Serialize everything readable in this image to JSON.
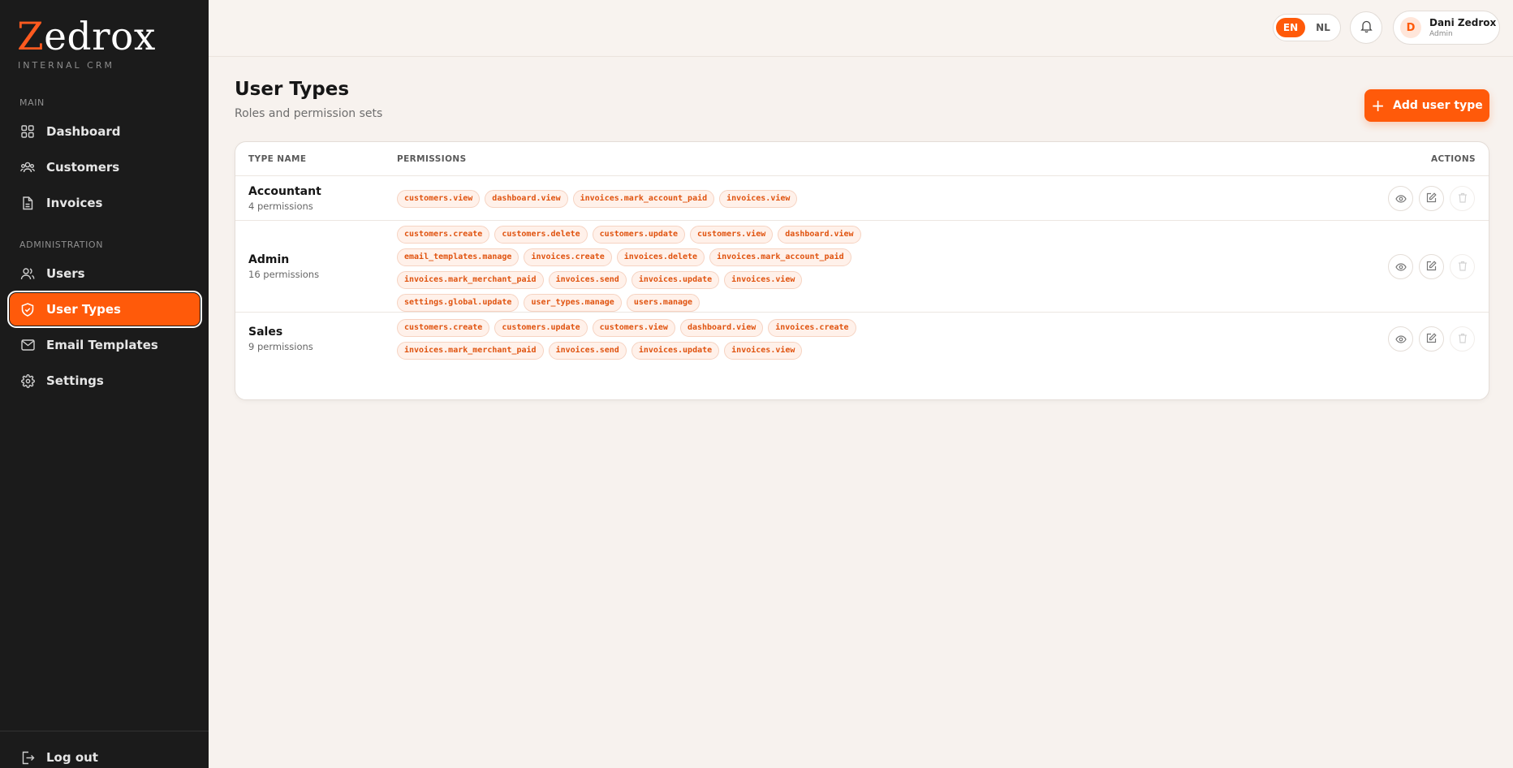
{
  "sidebar": {
    "logo_initial": "Z",
    "logo_rest": "edrox",
    "logo_sub": "INTERNAL CRM",
    "sections": {
      "main": "MAIN",
      "administration": "ADMINISTRATION"
    },
    "items": [
      {
        "label": "Dashboard",
        "icon": "grid-icon"
      },
      {
        "label": "Customers",
        "icon": "users-group-icon"
      },
      {
        "label": "Invoices",
        "icon": "document-icon"
      },
      {
        "label": "Users",
        "icon": "users-icon"
      },
      {
        "label": "User Types",
        "icon": "shield-icon",
        "active": true
      },
      {
        "label": "Email Templates",
        "icon": "mail-icon"
      },
      {
        "label": "Settings",
        "icon": "gear-icon"
      }
    ],
    "logout_label": "Log out"
  },
  "topbar": {
    "languages": [
      "EN",
      "NL"
    ],
    "active_language": "EN",
    "user": {
      "initial": "D",
      "name": "Dani Zedrox",
      "role": "Admin"
    }
  },
  "page": {
    "title": "User Types",
    "subtitle": "Roles and permission sets",
    "add_button_label": "Add user type"
  },
  "table": {
    "columns": [
      "TYPE NAME",
      "PERMISSIONS",
      "ACTIONS"
    ],
    "rows": [
      {
        "name": "Accountant",
        "count": "4 permissions",
        "permissions": [
          "customers.view",
          "dashboard.view",
          "invoices.mark_account_paid",
          "invoices.view"
        ]
      },
      {
        "name": "Admin",
        "count": "16 permissions",
        "permissions": [
          "customers.create",
          "customers.delete",
          "customers.update",
          "customers.view",
          "dashboard.view",
          "email_templates.manage",
          "invoices.create",
          "invoices.delete",
          "invoices.mark_account_paid",
          "invoices.mark_merchant_paid",
          "invoices.send",
          "invoices.update",
          "invoices.view",
          "settings.global.update",
          "user_types.manage",
          "users.manage"
        ]
      },
      {
        "name": "Sales",
        "count": "9 permissions",
        "permissions": [
          "customers.create",
          "customers.update",
          "customers.view",
          "dashboard.view",
          "invoices.create",
          "invoices.mark_merchant_paid",
          "invoices.send",
          "invoices.update",
          "invoices.view"
        ]
      }
    ]
  },
  "colors": {
    "accent": "#ff5a0a",
    "sidebar_bg": "#1b1b1b",
    "page_bg": "#f7f2ee"
  }
}
